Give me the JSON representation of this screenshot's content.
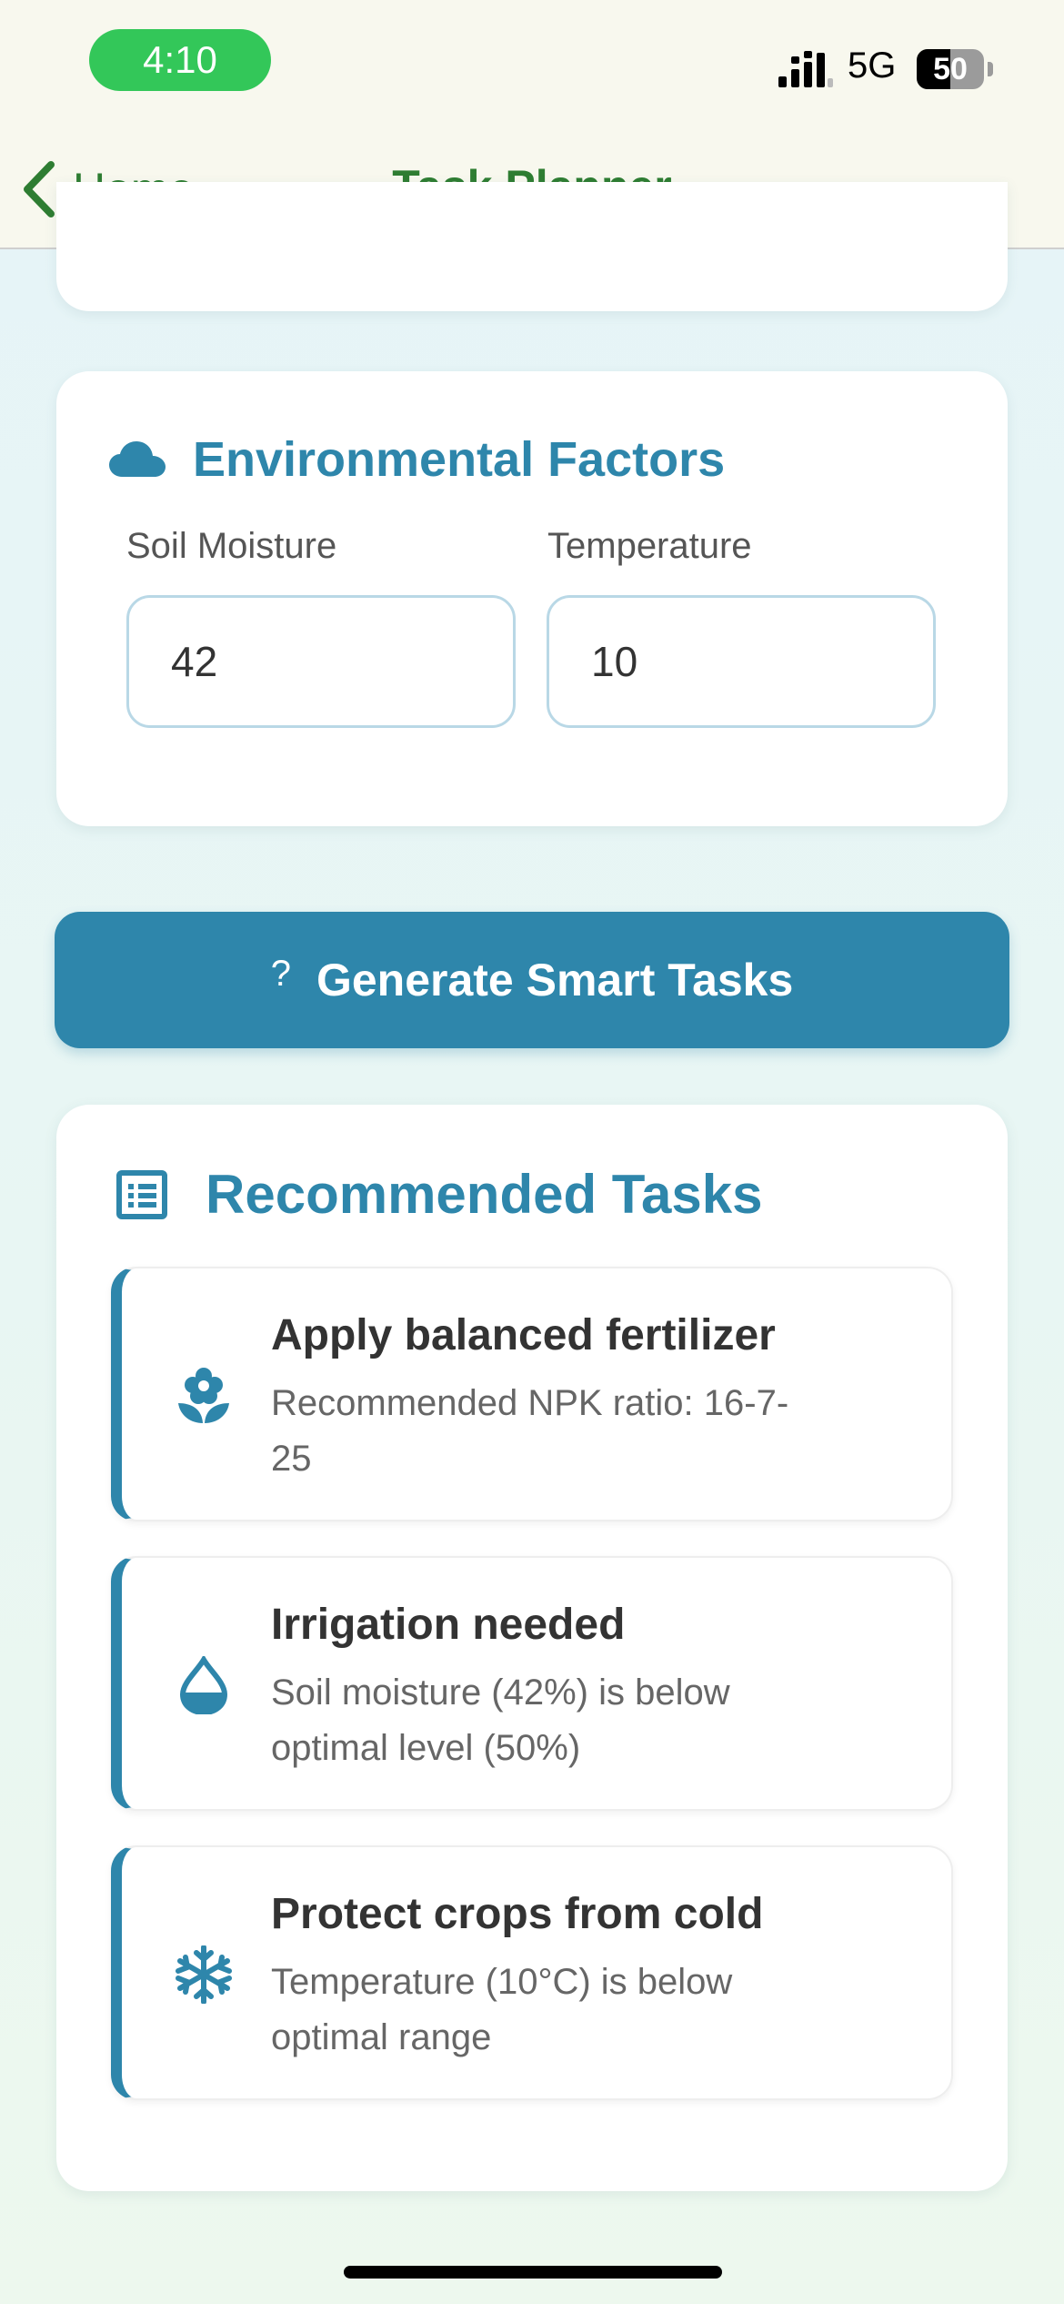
{
  "status_bar": {
    "time": "4:10",
    "network": "5G",
    "battery": "50"
  },
  "nav": {
    "back_label": "Home",
    "title": "Task Planner"
  },
  "environment": {
    "title": "Environmental Factors",
    "icon": "cloud-icon",
    "soil_moisture": {
      "label": "Soil Moisture",
      "value": "42"
    },
    "temperature": {
      "label": "Temperature",
      "value": "10"
    }
  },
  "generate_button": {
    "icon": "?",
    "label": "Generate Smart Tasks"
  },
  "tasks": {
    "title": "Recommended Tasks",
    "icon": "list-icon",
    "items": [
      {
        "icon": "flower-icon",
        "title": "Apply balanced fertilizer",
        "description": "Recommended NPK ratio: 16-7-25"
      },
      {
        "icon": "water-drop-icon",
        "title": "Irrigation needed",
        "description": "Soil moisture (42%) is below optimal level (50%)"
      },
      {
        "icon": "snowflake-icon",
        "title": "Protect crops from cold",
        "description": "Temperature (10°C) is below optimal range"
      }
    ]
  },
  "colors": {
    "accent_blue": "#2e86ab",
    "nav_green": "#2e7d32",
    "time_pill_green": "#33c759",
    "header_background": "#f8f8ee"
  }
}
